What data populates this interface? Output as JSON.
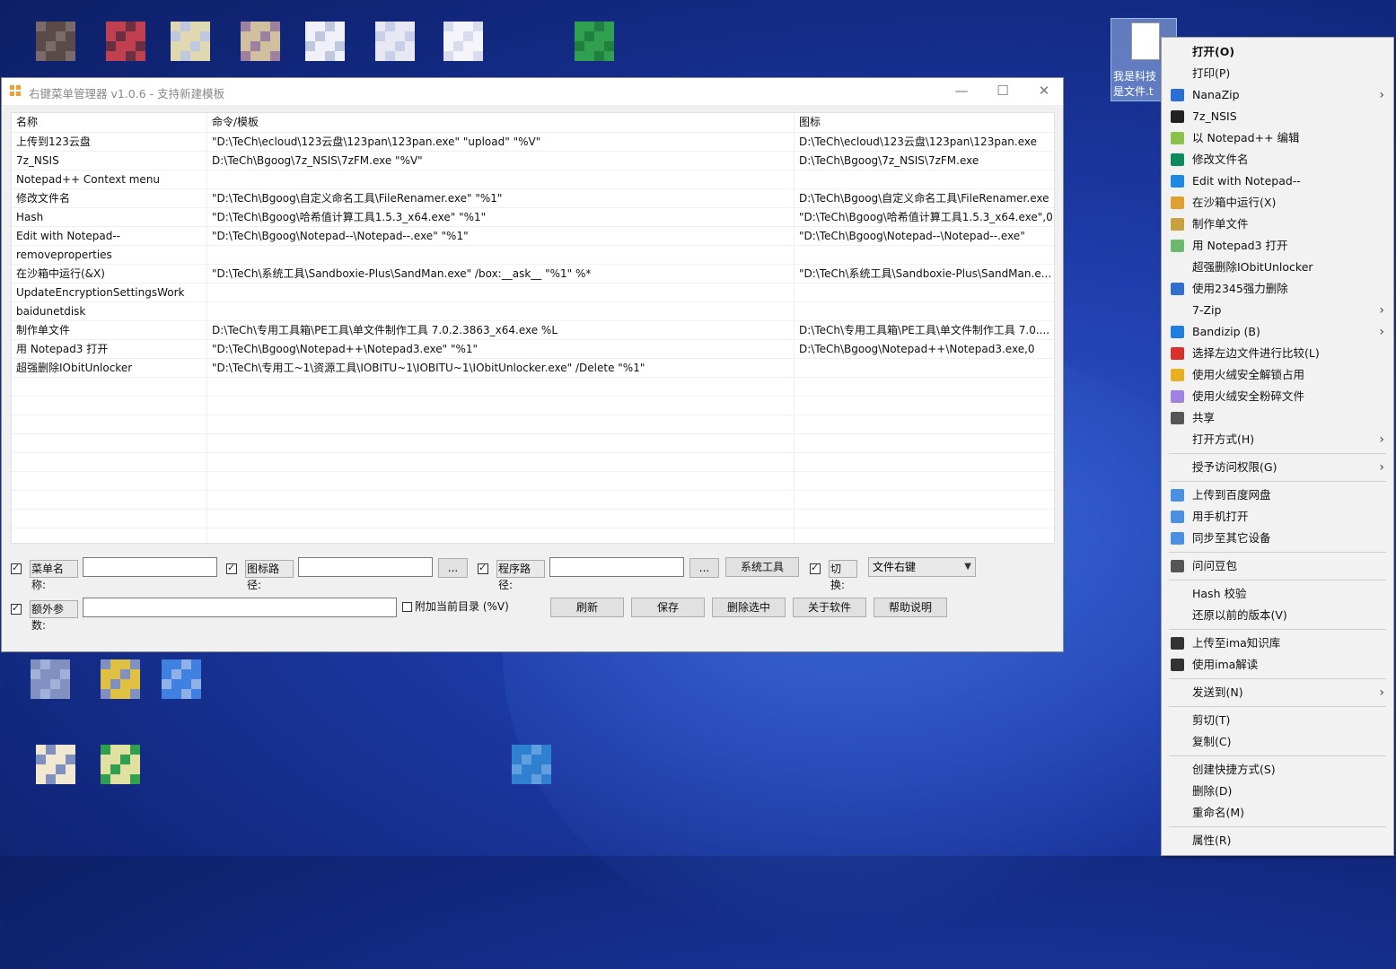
{
  "window": {
    "title": "右键菜单管理器 v1.0.6 - 支持新建模板",
    "min_glyph": "—",
    "max_glyph": "☐",
    "close_glyph": "✕"
  },
  "table": {
    "headers": [
      "名称",
      "命令/模板",
      "图标"
    ],
    "rows": [
      [
        "上传到123云盘",
        "\"D:\\TeCh\\ecloud\\123云盘\\123pan\\123pan.exe\" \"upload\" \"%V\"",
        "D:\\TeCh\\ecloud\\123云盘\\123pan\\123pan.exe"
      ],
      [
        "7z_NSIS",
        "D:\\TeCh\\Bgoog\\7z_NSIS\\7zFM.exe \"%V\"",
        "D:\\TeCh\\Bgoog\\7z_NSIS\\7zFM.exe"
      ],
      [
        "Notepad++ Context menu",
        "",
        ""
      ],
      [
        "修改文件名",
        "\"D:\\TeCh\\Bgoog\\自定义命名工具\\FileRenamer.exe\" \"%1\"",
        "D:\\TeCh\\Bgoog\\自定义命名工具\\FileRenamer.exe"
      ],
      [
        "Hash",
        "\"D:\\TeCh\\Bgoog\\哈希值计算工具1.5.3_x64.exe\" \"%1\"",
        "\"D:\\TeCh\\Bgoog\\哈希值计算工具1.5.3_x64.exe\",0"
      ],
      [
        "Edit with Notepad--",
        "\"D:\\TeCh\\Bgoog\\Notepad--\\Notepad--.exe\" \"%1\"",
        "\"D:\\TeCh\\Bgoog\\Notepad--\\Notepad--.exe\""
      ],
      [
        "removeproperties",
        "",
        ""
      ],
      [
        "在沙箱中运行(&X)",
        "\"D:\\TeCh\\系统工具\\Sandboxie-Plus\\SandMan.exe\" /box:__ask__ \"%1\" %*",
        "\"D:\\TeCh\\系统工具\\Sandboxie-Plus\\SandMan.e..."
      ],
      [
        "UpdateEncryptionSettingsWork",
        "",
        ""
      ],
      [
        "baidunetdisk",
        "",
        ""
      ],
      [
        "制作单文件",
        "D:\\TeCh\\专用工具箱\\PE工具\\单文件制作工具 7.0.2.3863_x64.exe %L",
        "D:\\TeCh\\专用工具箱\\PE工具\\单文件制作工具 7.0...."
      ],
      [
        "用 Notepad3 打开",
        "\"D:\\TeCh\\Bgoog\\Notepad++\\Notepad3.exe\" \"%1\"",
        "D:\\TeCh\\Bgoog\\Notepad++\\Notepad3.exe,0"
      ],
      [
        "超强删除IObitUnlocker",
        "\"D:\\TeCh\\专用工~1\\资源工具\\IOBITU~1\\IOBITU~1\\IObitUnlocker.exe\" /Delete \"%1\"",
        ""
      ],
      [
        "",
        "",
        ""
      ],
      [
        "",
        "",
        ""
      ],
      [
        "",
        "",
        ""
      ],
      [
        "",
        "",
        ""
      ],
      [
        "",
        "",
        ""
      ],
      [
        "",
        "",
        ""
      ],
      [
        "",
        "",
        ""
      ],
      [
        "",
        "",
        ""
      ],
      [
        "",
        "",
        ""
      ]
    ]
  },
  "form": {
    "menu_name_label": "菜单名称:",
    "icon_path_label": "图标路径:",
    "program_path_label": "程序路径:",
    "browse1": "...",
    "browse2": "...",
    "system_tools": "系统工具",
    "switch_label": "切换:",
    "switch_value": "文件右键",
    "extra_params_label": "额外参数:",
    "append_dir_label": "附加当前目录 (%V)",
    "refresh": "刷新",
    "save": "保存",
    "delete_selected": "删除选中",
    "about": "关于软件",
    "help": "帮助说明"
  },
  "selected_file_label": "我是科技\n是文件.t",
  "context_menu": [
    {
      "label": "打开(O)",
      "bold": true
    },
    {
      "label": "打印(P)"
    },
    {
      "label": "NanaZip",
      "icon_color": "#2a6fd6",
      "sub": true
    },
    {
      "label": "7z_NSIS",
      "icon_color": "#222"
    },
    {
      "label": "以 Notepad++ 编辑",
      "icon_color": "#8bc34a"
    },
    {
      "label": "修改文件名",
      "icon_color": "#0f8a5f"
    },
    {
      "label": "Edit with Notepad--",
      "icon_color": "#1e88e5"
    },
    {
      "label": "在沙箱中运行(X)",
      "icon_color": "#e0a030"
    },
    {
      "label": "制作单文件",
      "icon_color": "#c8a040"
    },
    {
      "label": "用 Notepad3 打开",
      "icon_color": "#6cb86c"
    },
    {
      "label": "超强删除IObitUnlocker"
    },
    {
      "label": "使用2345强力删除",
      "icon_color": "#2f6fd0"
    },
    {
      "label": "7-Zip",
      "sub": true
    },
    {
      "label": "Bandizip (B)",
      "icon_color": "#1e7fe0",
      "sub": true
    },
    {
      "label": "选择左边文件进行比较(L)",
      "icon_color": "#d8302a"
    },
    {
      "label": "使用火绒安全解锁占用",
      "icon_color": "#e8b020"
    },
    {
      "label": "使用火绒安全粉碎文件",
      "icon_color": "#a080e0"
    },
    {
      "label": "共享",
      "icon_color": "#555"
    },
    {
      "label": "打开方式(H)",
      "sub": true
    },
    {
      "sep": true
    },
    {
      "label": "授予访问权限(G)",
      "sub": true
    },
    {
      "sep": true
    },
    {
      "label": "上传到百度网盘",
      "icon_color": "#4a90e2"
    },
    {
      "label": "用手机打开",
      "icon_color": "#4a90e2"
    },
    {
      "label": "同步至其它设备",
      "icon_color": "#4a90e2"
    },
    {
      "sep": true
    },
    {
      "label": "问问豆包",
      "icon_color": "#555"
    },
    {
      "sep": true
    },
    {
      "label": "Hash 校验"
    },
    {
      "label": "还原以前的版本(V)"
    },
    {
      "sep": true
    },
    {
      "label": "上传至ima知识库",
      "icon_color": "#333"
    },
    {
      "label": "使用ima解读",
      "icon_color": "#333"
    },
    {
      "sep": true
    },
    {
      "label": "发送到(N)",
      "sub": true
    },
    {
      "sep": true
    },
    {
      "label": "剪切(T)"
    },
    {
      "label": "复制(C)"
    },
    {
      "sep": true
    },
    {
      "label": "创建快捷方式(S)"
    },
    {
      "label": "删除(D)"
    },
    {
      "label": "重命名(M)"
    },
    {
      "sep": true
    },
    {
      "label": "属性(R)"
    }
  ]
}
